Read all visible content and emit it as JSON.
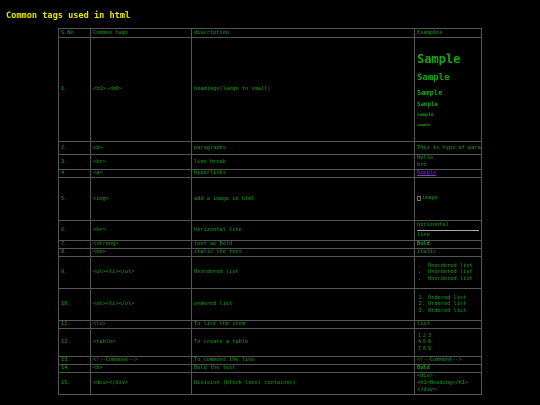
{
  "title": "Common tags used in html",
  "headers": [
    "S.No",
    "Common tags",
    "discription",
    "Examples"
  ],
  "rows": [
    {
      "sno": "1.",
      "tag": "<h1>-<h6>",
      "desc": "headings(large to small)"
    },
    {
      "sno": "2.",
      "tag": "<p>",
      "desc": "paragraphs"
    },
    {
      "sno": "3.",
      "tag": "<br>",
      "desc": "line break"
    },
    {
      "sno": "4.",
      "tag": "<a>",
      "desc": "hyperlinks"
    },
    {
      "sno": "5.",
      "tag": "<img>",
      "desc": "add a image in html"
    },
    {
      "sno": "6.",
      "tag": "<hr>",
      "desc": "horizontal line"
    },
    {
      "sno": "7.",
      "tag": "<strong>",
      "desc": "text as Bold"
    },
    {
      "sno": "8.",
      "tag": "<em>",
      "desc": "italic the text"
    },
    {
      "sno": "9.",
      "tag": "<ul><li></ul>",
      "desc": "Unordered list"
    },
    {
      "sno": "10.",
      "tag": "<ol><li></ol>",
      "desc": "ordered list"
    },
    {
      "sno": "11.",
      "tag": "<li>",
      "desc": "To list the item"
    },
    {
      "sno": "12.",
      "tag": "<table>",
      "desc": "To create a table"
    },
    {
      "sno": "13.",
      "tag": "<!--Comment-->",
      "desc": "To comment the line"
    },
    {
      "sno": "14.",
      "tag": "<b>",
      "desc": "Bold the text"
    },
    {
      "sno": "15.",
      "tag": "<div></div>",
      "desc": "Division (block-level container)"
    }
  ],
  "examples": {
    "headings": [
      "Sample",
      "Sample",
      "Sample",
      "Sample",
      "sample",
      "sample"
    ],
    "paragraph": "This is type of paragraphs",
    "linebreak": [
      "Hello",
      "bro"
    ],
    "link": "Google",
    "image_alt": "image",
    "hr": [
      "horizontal",
      "line"
    ],
    "strong": "Bold",
    "em": "italic",
    "ul": [
      "Unordered list",
      "Unordered list",
      "Unordered list"
    ],
    "ol": [
      "Ordered list",
      "Ordered list",
      "Ordered list"
    ],
    "li": "list",
    "table": [
      [
        "1",
        "2",
        "3"
      ],
      [
        "4",
        "5",
        "6"
      ],
      [
        "7",
        "8",
        "9"
      ]
    ],
    "comment": "<!--Comment-->",
    "b": "Bold",
    "div": [
      "<div>",
      "<h1>Heading</h1>",
      "</div>"
    ]
  },
  "colors": {
    "background": "#000000",
    "text": "#19a319",
    "title": "#e6e60a",
    "link": "#8d2be0",
    "border": "#555555"
  }
}
